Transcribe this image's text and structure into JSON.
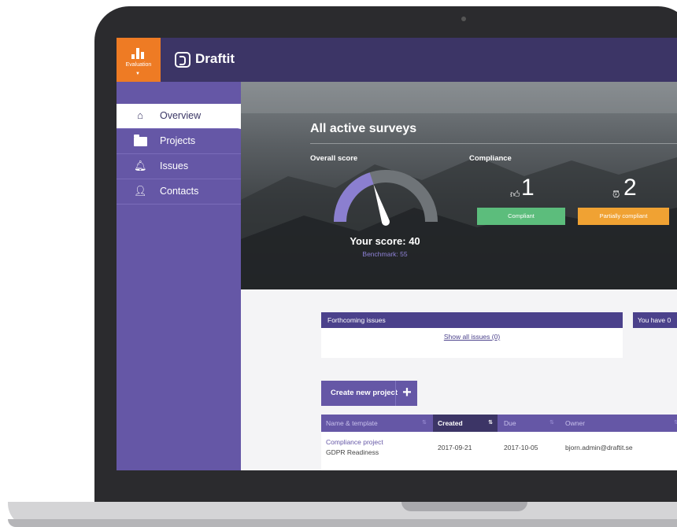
{
  "app": {
    "evaluation_label": "Evaluation",
    "brand_name": "Draftit"
  },
  "sidebar": {
    "items": [
      {
        "label": "Overview",
        "icon": "home-icon",
        "active": true
      },
      {
        "label": "Projects",
        "icon": "folder-icon"
      },
      {
        "label": "Issues",
        "icon": "bell-icon"
      },
      {
        "label": "Contacts",
        "icon": "person-icon"
      }
    ]
  },
  "hero": {
    "title": "All active surveys",
    "overall_score_label": "Overall score",
    "compliance_label": "Compliance",
    "score_text": "Your score: 40",
    "benchmark_text": "Benchmark: 55",
    "score_value": 40,
    "score_max": 100,
    "stats": [
      {
        "value": "1",
        "icon": "thumbs-up-icon",
        "badge": "Compliant",
        "color": "#5cbd7c"
      },
      {
        "value": "2",
        "icon": "alarm-clock-icon",
        "badge": "Partially compliant",
        "color": "#f0a233"
      }
    ]
  },
  "issues_panel": {
    "title": "Forthcoming issues",
    "link": "Show all issues (0)"
  },
  "notice_panel": {
    "title": "You have 0"
  },
  "projects": {
    "create_button": "Create new project",
    "columns": [
      "Name & template",
      "Created",
      "Due",
      "Owner"
    ],
    "sorted_column": "Created",
    "rows": [
      {
        "name": "Compliance project",
        "template": "GDPR Readiness",
        "created": "2017-09-21",
        "due": "2017-10-05",
        "owner": "bjorn.admin@draftit.se"
      }
    ]
  },
  "colors": {
    "topbar": "#3c3566",
    "sidebar": "#6557a6",
    "accent_orange": "#ee7b24",
    "compliant_green": "#5cbd7c",
    "partial_orange": "#f0a233"
  }
}
